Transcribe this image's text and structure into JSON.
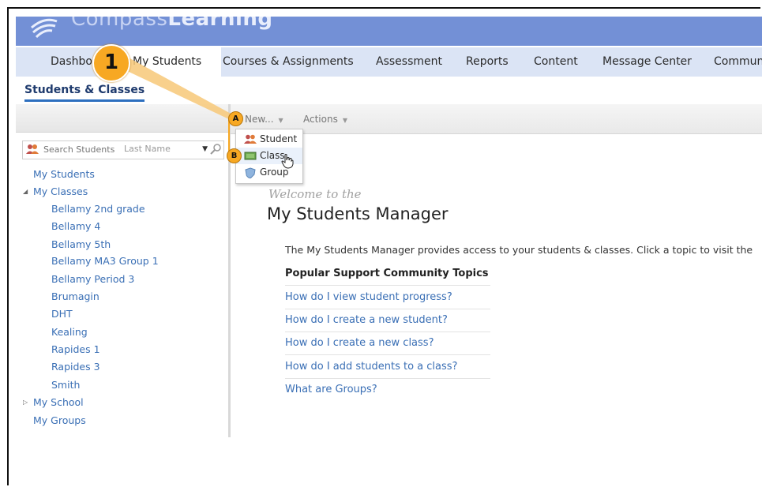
{
  "header": {
    "logo_prefix": "Compass",
    "logo_suffix": "Learning"
  },
  "nav": {
    "tabs": [
      {
        "label": "Dashboard"
      },
      {
        "label": "My Students",
        "active": true
      },
      {
        "label": "Courses & Assignments"
      },
      {
        "label": "Assessment"
      },
      {
        "label": "Reports"
      },
      {
        "label": "Content"
      },
      {
        "label": "Message Center"
      },
      {
        "label": "Community"
      }
    ]
  },
  "subnav": {
    "tab": "Students & Classes"
  },
  "sidebar": {
    "search": {
      "placeholder": "Search Students",
      "field": "Last Name"
    },
    "tree": {
      "my_students": "My Students",
      "my_classes": "My Classes",
      "classes": [
        "Bellamy 2nd grade",
        "Bellamy 4",
        "Bellamy 5th",
        "Bellamy MA3 Group 1",
        "Bellamy Period 3",
        "Brumagin",
        "DHT",
        "Kealing",
        "Rapides 1",
        "Rapides 3",
        "Smith"
      ],
      "my_school": "My School",
      "my_groups": "My Groups"
    }
  },
  "toolbar": {
    "new_label": "New...",
    "actions_label": "Actions"
  },
  "new_menu": {
    "items": [
      {
        "label": "Student"
      },
      {
        "label": "Class"
      },
      {
        "label": "Group"
      }
    ]
  },
  "main": {
    "welcome": "Welcome to the",
    "title": "My Students Manager",
    "intro": "The My Students Manager provides access to your students & classes. Click a topic to visit the",
    "topics_title": "Popular Support Community Topics",
    "topics": [
      "How do I view student progress?",
      "How do I create a new student?",
      "How do I create a new class?",
      "How do I add students to a class?",
      "What are Groups?"
    ]
  },
  "callouts": {
    "step": "1",
    "a": "A",
    "b": "B"
  },
  "colors": {
    "banner": "#7390d6",
    "nav_bg": "#dbe4f5",
    "link": "#3a6fb5",
    "callout": "#f7a823"
  },
  "icons": [
    "compass-logo-icon",
    "students-icon",
    "magnifier-icon",
    "tree-expanded-icon",
    "tree-collapsed-icon",
    "student-icon",
    "class-icon",
    "group-shield-icon",
    "hand-cursor-icon"
  ]
}
